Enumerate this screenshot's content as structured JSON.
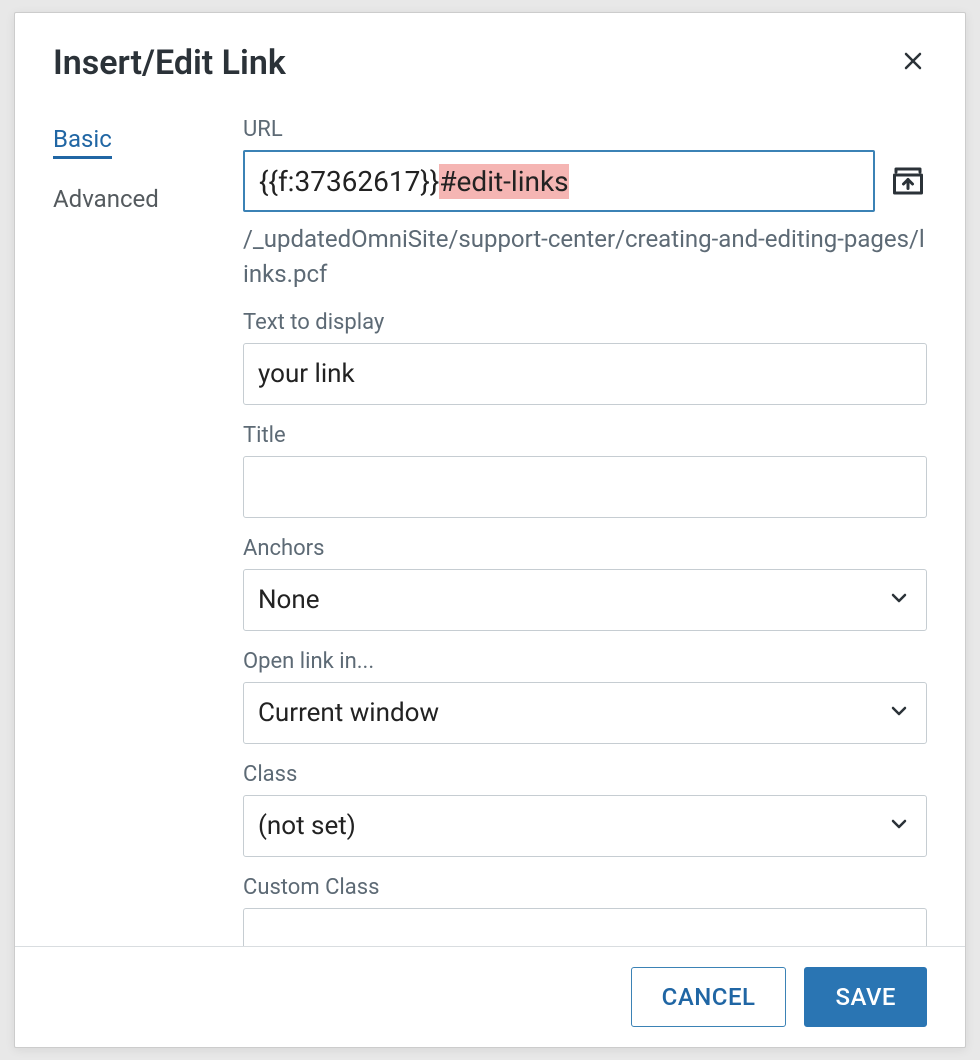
{
  "modal": {
    "title": "Insert/Edit Link"
  },
  "tabs": {
    "basic": "Basic",
    "advanced": "Advanced"
  },
  "fields": {
    "url": {
      "label": "URL",
      "value_prefix": "{{f:37362617}}",
      "value_highlighted": "#edit-links",
      "path": "/_updatedOmniSite/support-center/creating-and-editing-pages/links.pcf"
    },
    "text_to_display": {
      "label": "Text to display",
      "value": "your link"
    },
    "title_field": {
      "label": "Title",
      "value": ""
    },
    "anchors": {
      "label": "Anchors",
      "value": "None"
    },
    "open_link": {
      "label": "Open link in...",
      "value": "Current window"
    },
    "class": {
      "label": "Class",
      "value": "(not set)"
    },
    "custom_class": {
      "label": "Custom Class",
      "value": ""
    }
  },
  "buttons": {
    "cancel": "CANCEL",
    "save": "SAVE"
  }
}
